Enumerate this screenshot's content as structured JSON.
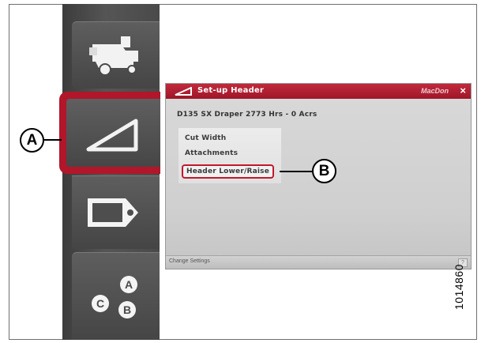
{
  "callouts": {
    "a": "A",
    "b": "B"
  },
  "sidebar": {
    "buttons": [
      {
        "icon": "combine-icon"
      },
      {
        "icon": "header-icon",
        "selected": true
      },
      {
        "icon": "tag-icon"
      },
      {
        "icon": "abc-icon"
      }
    ]
  },
  "dialog": {
    "title": "Set-up Header",
    "brand": "MacDon",
    "close_label": "×",
    "machine_info": "D135 SX Draper 2773 Hrs - 0 Acrs",
    "menu": [
      {
        "label": "Cut Width"
      },
      {
        "label": "Attachments"
      },
      {
        "label": "Header Lower/Raise",
        "highlighted": true
      }
    ],
    "status_text": "Change Settings",
    "status_button": "?"
  },
  "figure_number": "1014860",
  "colors": {
    "accent": "#b1162a",
    "titlebar": "#a81a2e"
  }
}
